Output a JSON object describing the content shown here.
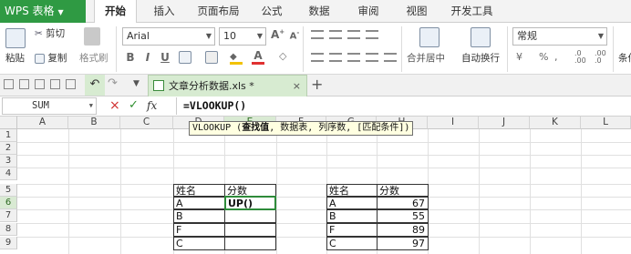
{
  "app": {
    "name": "WPS 表格"
  },
  "menu": [
    "开始",
    "插入",
    "页面布局",
    "公式",
    "数据",
    "审阅",
    "视图",
    "开发工具"
  ],
  "ribbon": {
    "paste": "粘贴",
    "cut": "剪切",
    "copy": "复制",
    "format_painter": "格式刷",
    "font_name": "Arial",
    "font_size": "10",
    "merge_center": "合并居中",
    "wrap_text": "自动换行",
    "number_format": "常规",
    "cond_format": "条件"
  },
  "doc_tab": {
    "file": "文章分析数据.xls *",
    "add": "+"
  },
  "formula_bar": {
    "name_box": "SUM",
    "cancel": "×",
    "confirm": "✓",
    "fx": "fx",
    "formula": "=VLOOKUP()"
  },
  "tooltip": {
    "func": "VLOOKUP (",
    "arg1": "查找值",
    "rest": ", 数据表, 列序数, [匹配条件])"
  },
  "columns": [
    "A",
    "B",
    "C",
    "D",
    "E",
    "F",
    "G",
    "H",
    "I",
    "J",
    "K",
    "L"
  ],
  "rows": [
    "1",
    "2",
    "3",
    "4",
    "5",
    "6",
    "7",
    "8",
    "9"
  ],
  "left_table": {
    "headers": [
      "姓名",
      "分数"
    ],
    "names": [
      "A",
      "B",
      "F",
      "C"
    ],
    "active_value": "UP()"
  },
  "right_table": {
    "headers": [
      "姓名",
      "分数"
    ],
    "names": [
      "A",
      "B",
      "F",
      "C"
    ],
    "scores": [
      "67",
      "55",
      "89",
      "97"
    ]
  },
  "colors": {
    "accent": "#2f9a43",
    "tab_highlight": "#d7ebd1"
  }
}
